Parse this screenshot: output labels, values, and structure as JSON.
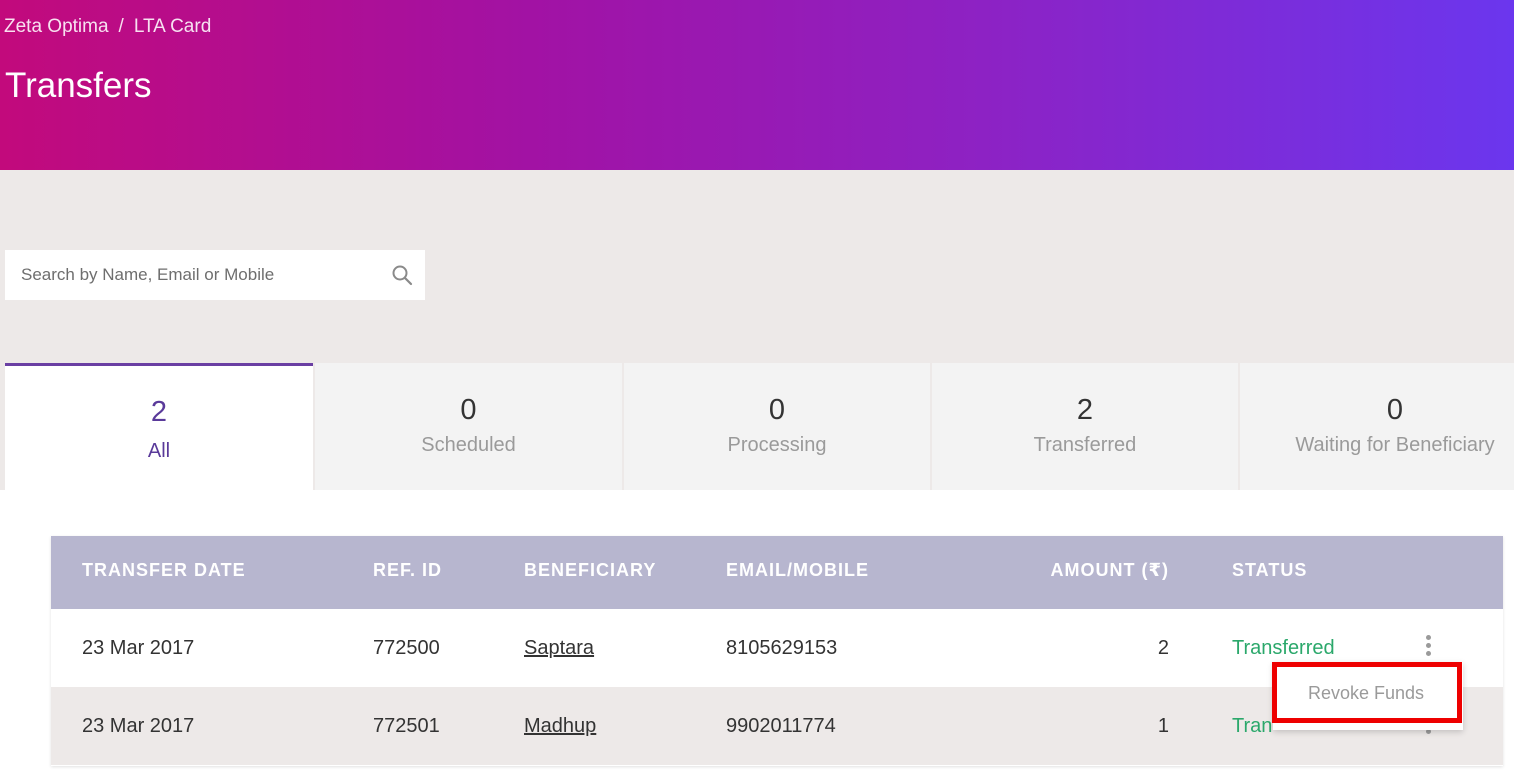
{
  "header": {
    "breadcrumb": [
      "Zeta Optima",
      "LTA Card"
    ],
    "breadcrumb_separator": "/",
    "title": "Transfers"
  },
  "search": {
    "placeholder": "Search by Name, Email or Mobile",
    "value": ""
  },
  "tabs": [
    {
      "count": "2",
      "label": "All",
      "active": true
    },
    {
      "count": "0",
      "label": "Scheduled",
      "active": false
    },
    {
      "count": "0",
      "label": "Processing",
      "active": false
    },
    {
      "count": "2",
      "label": "Transferred",
      "active": false
    },
    {
      "count": "0",
      "label": "Waiting for Beneficiary",
      "active": false
    }
  ],
  "table": {
    "columns": [
      "TRANSFER DATE",
      "REF. ID",
      "BENEFICIARY",
      "EMAIL/MOBILE",
      "AMOUNT (₹)",
      "STATUS"
    ],
    "rows": [
      {
        "date": "23 Mar 2017",
        "ref_id": "772500",
        "beneficiary": "Saptara",
        "contact": "8105629153",
        "amount": "2",
        "status": "Transferred"
      },
      {
        "date": "23 Mar 2017",
        "ref_id": "772501",
        "beneficiary": "Madhup",
        "contact": "9902011774",
        "amount": "1",
        "status": "Tran"
      }
    ]
  },
  "row_menu": {
    "items": [
      "Revoke Funds"
    ]
  },
  "colors": {
    "header_gradient_start": "#c20a7c",
    "header_gradient_end": "#6b36ee",
    "accent_purple": "#5a3a9a",
    "status_green": "#2ba86b",
    "table_header": "#b7b6cf",
    "highlight_red": "#ee0000"
  },
  "icons": {
    "search": "search-icon",
    "row_menu": "kebab-menu-icon"
  }
}
